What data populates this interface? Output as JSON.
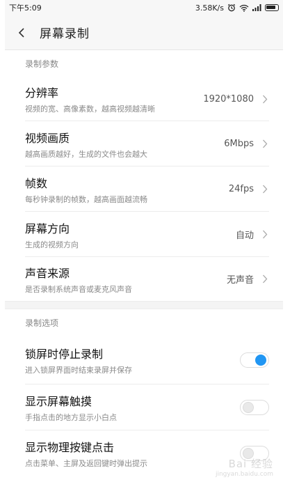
{
  "status_bar": {
    "time": "下午5:09",
    "network_speed": "3.58K/s",
    "icons": [
      "alarm-icon",
      "wifi-icon",
      "signal-icon",
      "battery-icon"
    ]
  },
  "header": {
    "back_icon": "chevron-left-icon",
    "title": "屏幕录制"
  },
  "sections": {
    "params": {
      "title": "录制参数",
      "items": [
        {
          "title": "分辨率",
          "subtitle": "视频的宽、高像素数，越高视频越清晰",
          "value": "1920*1080"
        },
        {
          "title": "视频画质",
          "subtitle": "越高画质越好，生成的文件也会越大",
          "value": "6Mbps"
        },
        {
          "title": "帧数",
          "subtitle": "每秒钟录制的帧数，越高画面越流畅",
          "value": "24fps"
        },
        {
          "title": "屏幕方向",
          "subtitle": "生成的视频方向",
          "value": "自动"
        },
        {
          "title": "声音来源",
          "subtitle": "是否录制系统声音或麦克风声音",
          "value": "无声音"
        }
      ]
    },
    "options": {
      "title": "录制选项",
      "items": [
        {
          "title": "锁屏时停止录制",
          "subtitle": "进入锁屏界面时结束录屏并保存",
          "enabled": true
        },
        {
          "title": "显示屏幕触摸",
          "subtitle": "手指点击的地方显示小白点",
          "enabled": false
        },
        {
          "title": "显示物理按键点击",
          "subtitle": "点击菜单、主屏及返回键时弹出提示",
          "enabled": false
        }
      ]
    }
  },
  "watermark": {
    "logo": "Bai 经验",
    "sub": "jingyan.baidu.com"
  },
  "colors": {
    "accent": "#2196f3",
    "background": "#ffffff",
    "header_bg": "#f7f7f7"
  }
}
